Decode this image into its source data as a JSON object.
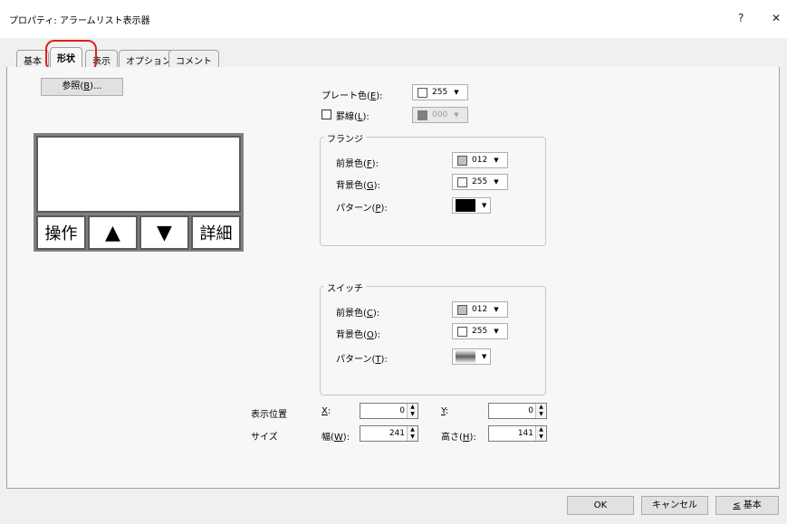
{
  "window": {
    "title": "プロパティ: アラームリスト表示器",
    "help": "?",
    "close": "✕"
  },
  "tabs": [
    {
      "label": "基本"
    },
    {
      "label": "形状"
    },
    {
      "label": "表示"
    },
    {
      "label": "オプション"
    },
    {
      "label": "コメント"
    }
  ],
  "browse_button": {
    "label": "参照(",
    "key": "B",
    "suffix": ")..."
  },
  "plate_color": {
    "label": "プレート色(",
    "key": "E",
    "suffix": "):",
    "value": "255",
    "swatch": "#ffffff"
  },
  "border": {
    "label": "罫線(",
    "key": "L",
    "suffix": "):",
    "checked": false,
    "value": "000",
    "swatch": "#808080"
  },
  "flange": {
    "title": "フランジ",
    "fg": {
      "label": "前景色(",
      "key": "F",
      "suffix": "):",
      "value": "012",
      "swatch": "#c0c0c0"
    },
    "bg": {
      "label": "背景色(",
      "key": "G",
      "suffix": "):",
      "value": "255",
      "swatch": "#ffffff"
    },
    "pattern": {
      "label": "パターン(",
      "key": "P",
      "suffix": "):"
    }
  },
  "switch": {
    "title": "スイッチ",
    "fg": {
      "label": "前景色(",
      "key": "C",
      "suffix": "):",
      "value": "012",
      "swatch": "#c0c0c0"
    },
    "bg": {
      "label": "背景色(",
      "key": "O",
      "suffix": "):",
      "value": "255",
      "swatch": "#ffffff"
    },
    "pattern": {
      "label": "パターン(",
      "key": "T",
      "suffix": "):"
    }
  },
  "preview": {
    "buttons": [
      "操作",
      "▲",
      "▼",
      "詳細"
    ]
  },
  "position": {
    "label": "表示位置",
    "x": {
      "label": "X",
      "suffix": ":",
      "value": "0"
    },
    "y": {
      "label": "Y",
      "suffix": ":",
      "value": "0"
    }
  },
  "size": {
    "label": "サイズ",
    "w": {
      "label": "幅(",
      "key": "W",
      "suffix": "):",
      "value": "241"
    },
    "h": {
      "label": "高さ(",
      "key": "H",
      "suffix": "):",
      "value": "141"
    }
  },
  "footer": {
    "ok": "OK",
    "cancel": "キャンセル",
    "basic_key": "≤",
    "basic": " 基本"
  },
  "colors": {
    "highlight": "#e0201a"
  }
}
